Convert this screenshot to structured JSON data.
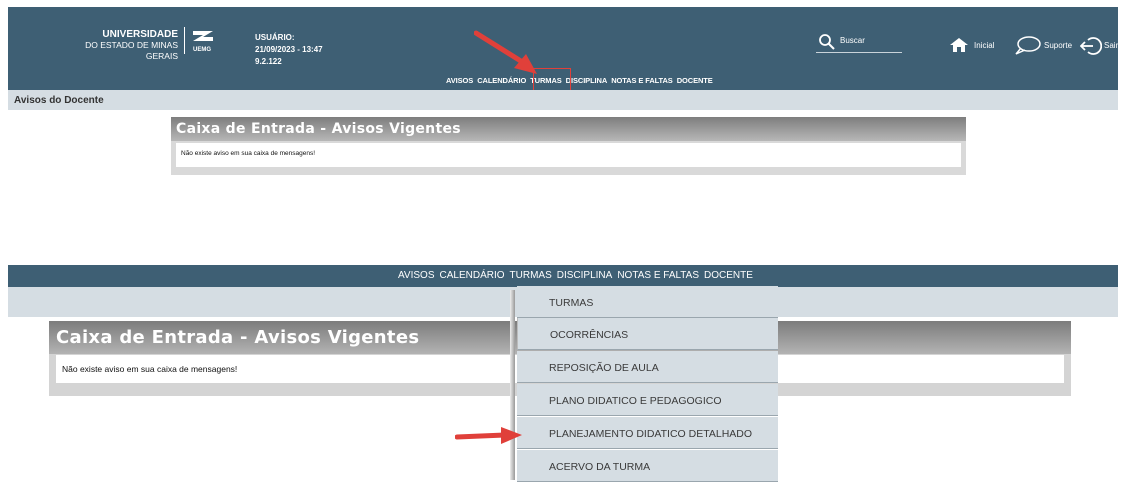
{
  "header": {
    "logo_line1": "UNIVERSIDADE",
    "logo_line2": "DO ESTADO DE MINAS GERAIS",
    "logo_mark_text": "UEMG",
    "user_label": "USUÁRIO:",
    "datetime": "21/09/2023 - 13:47",
    "version": "9.2.122",
    "search_label": "Buscar",
    "home_label": "Inicial",
    "support_label": "Suporte",
    "exit_label": "Sair"
  },
  "nav": {
    "items": [
      "AVISOS",
      "CALENDÁRIO",
      "TURMAS",
      "DISCIPLINA",
      "NOTAS E FALTAS",
      "DOCENTE"
    ]
  },
  "subbar": {
    "title": "Avisos do Docente"
  },
  "inbox": {
    "title": "Caixa de Entrada - Avisos Vigentes",
    "message": "Não existe aviso em sua caixa de mensagens!"
  },
  "dropdown": {
    "items": [
      "TURMAS",
      "OCORRÊNCIAS",
      "REPOSIÇÃO DE AULA",
      "PLANO DIDATICO E PEDAGOGICO",
      "PLANEJAMENTO DIDATICO DETALHADO",
      "ACERVO DA TURMA"
    ]
  },
  "colors": {
    "header_bg": "#3e5f74",
    "subbar_bg": "#d5dde3",
    "annotation_red": "#e0403a"
  },
  "icons": [
    "search-icon",
    "home-icon",
    "speech-bubble-icon",
    "exit-icon",
    "uemg-logo-icon",
    "red-arrow-icon"
  ]
}
